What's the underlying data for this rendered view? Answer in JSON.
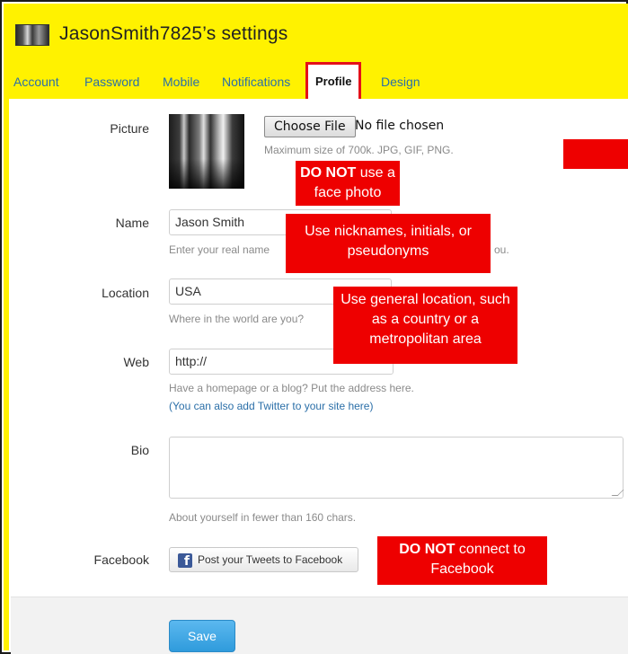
{
  "header": {
    "title": "JasonSmith7825’s settings"
  },
  "tabs": [
    {
      "label": "Account"
    },
    {
      "label": "Password"
    },
    {
      "label": "Mobile"
    },
    {
      "label": "Notifications"
    },
    {
      "label": "Profile",
      "active": true
    },
    {
      "label": "Design"
    }
  ],
  "picture": {
    "label": "Picture",
    "choose_file_label": "Choose File",
    "no_file_text": "No file chosen",
    "hint": "Maximum size of 700k. JPG, GIF, PNG."
  },
  "name": {
    "label": "Name",
    "value": "Jason Smith",
    "hint_start": "Enter your real name",
    "hint_end": "ou."
  },
  "location": {
    "label": "Location",
    "value": "USA",
    "hint": "Where in the world are you?"
  },
  "web": {
    "label": "Web",
    "value": "http://",
    "hint": "Have a homepage or a blog? Put the address here.",
    "twitter_link": "(You can also add Twitter to your site here)"
  },
  "bio": {
    "label": "Bio",
    "value": "",
    "hint": "About yourself in fewer than 160 chars."
  },
  "facebook": {
    "label": "Facebook",
    "button_label": "Post your Tweets to Facebook"
  },
  "save_label": "Save",
  "callouts": {
    "photo": {
      "strong": "DO NOT",
      "rest": " use a face photo"
    },
    "name": {
      "text": "Use nicknames, initials, or pseudonyms"
    },
    "location": {
      "text": "Use general location, such as a country or a metropolitan area"
    },
    "facebook": {
      "strong": "DO NOT",
      "rest": " connect to Facebook"
    }
  },
  "colors": {
    "highlight_yellow": "#fff200",
    "callout_red": "#ee0000",
    "link_blue": "#2b6fa8",
    "save_blue": "#3aa5e5"
  }
}
